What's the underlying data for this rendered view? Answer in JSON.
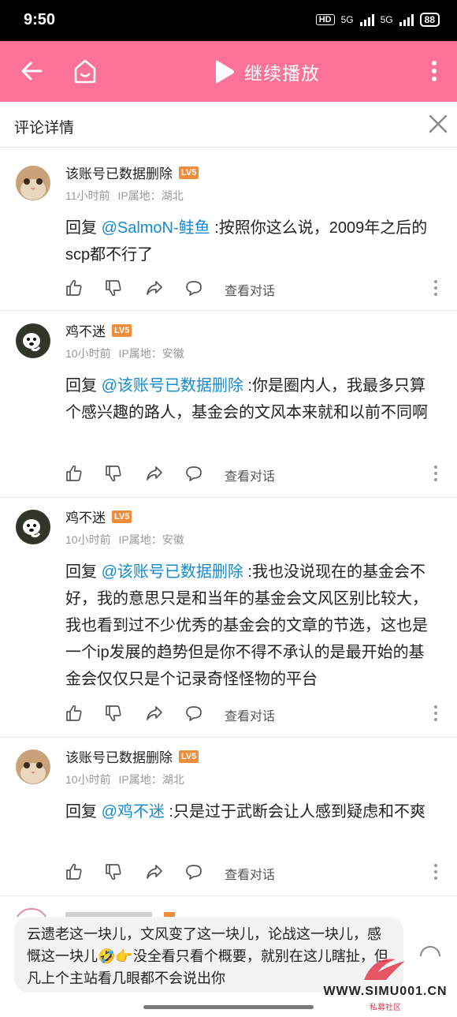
{
  "status_bar": {
    "time": "9:50",
    "hd": "HD",
    "net1": "5G",
    "net2": "5G",
    "battery": "88"
  },
  "topbar": {
    "play_label": "继续播放",
    "accent_color": "#fb7299"
  },
  "detail": {
    "title": "评论详情"
  },
  "comments": [
    {
      "user": "该账号已数据删除",
      "level": "LV5",
      "time": "11小时前",
      "ip": "IP属地：湖北",
      "reply_prefix": "回复 ",
      "mention": "@SalmoN-鲑鱼",
      "text": " :按照你这么说，2009年之后的scp都不行了",
      "actions": {
        "view_dialog": "查看对话"
      }
    },
    {
      "user": "鸡不迷",
      "level": "LV5",
      "time": "10小时前",
      "ip": "IP属地：安徽",
      "reply_prefix": "回复 ",
      "mention": "@该账号已数据删除",
      "text": " :你是圈内人，我最多只算个感兴趣的路人，基金会的文风本来就和以前不同啊",
      "actions": {
        "view_dialog": "查看对话"
      }
    },
    {
      "user": "鸡不迷",
      "level": "LV5",
      "time": "10小时前",
      "ip": "IP属地：安徽",
      "reply_prefix": "回复 ",
      "mention": "@该账号已数据删除",
      "text": " :我也没说现在的基金会不好，我的意思只是和当年的基金会文风区别比较大，我也看到过不少优秀的基金会的文章的节选，这也是一个ip发展的趋势但是你不得不承认的是最开始的基金会仅仅只是个记录奇怪怪物的平台",
      "actions": {
        "view_dialog": "查看对话"
      }
    },
    {
      "user": "该账号已数据删除",
      "level": "LV5",
      "time": "10小时前",
      "ip": "IP属地：湖北",
      "reply_prefix": "回复 ",
      "mention": "@鸡不迷",
      "text": " :只是过于武断会让人感到疑虑和不爽",
      "actions": {
        "view_dialog": "查看对话"
      }
    }
  ],
  "bubble": {
    "text": "云遗老这一块儿，文风变了这一块儿，论战这一块儿，感慨这一块儿🤣👉没全看只看个概要，就别在这儿瞎扯，但凡上个主站看几眼都不会说出你"
  },
  "watermark": {
    "url": "WWW.SIMU001.CN",
    "sub": "私募社区"
  }
}
